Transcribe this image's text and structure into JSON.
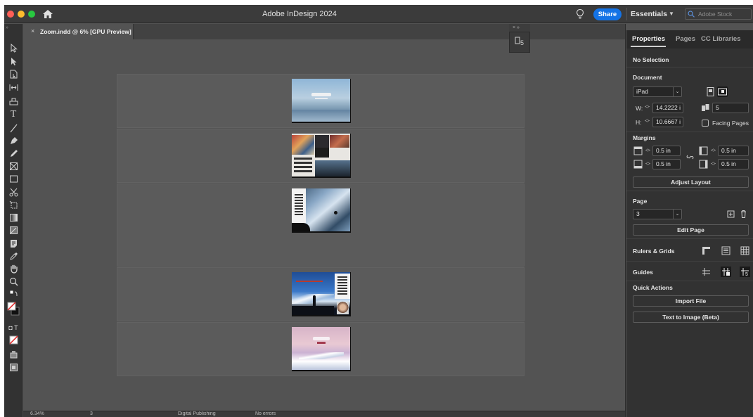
{
  "window": {
    "title": "Adobe InDesign 2024",
    "share_label": "Share",
    "workspace": "Essentials",
    "stock_search_placeholder": "Adobe Stock"
  },
  "document_tab": {
    "close_glyph": "×",
    "label": "Zoom.indd @ 6% [GPU Preview]"
  },
  "float_panel": {
    "header_glyphs": "× »"
  },
  "status_bar": {
    "zoom": "6.34%",
    "page": "3",
    "profile": "Digital Publishing",
    "errors": "No errors"
  },
  "panel": {
    "tabs": [
      {
        "label": "Properties",
        "active": true
      },
      {
        "label": "Pages",
        "active": false
      },
      {
        "label": "CC Libraries",
        "active": false
      }
    ],
    "selection_status": "No Selection",
    "document": {
      "title": "Document",
      "preset": "iPad",
      "width_label": "W:",
      "width": "14.2222 i",
      "height_label": "H:",
      "height": "10.6667 i",
      "pages_count": "5",
      "facing_pages_label": "Facing Pages",
      "facing_pages_checked": false
    },
    "margins": {
      "title": "Margins",
      "top": "0.5 in",
      "bottom": "0.5 in",
      "left": "0.5 in",
      "right": "0.5 in",
      "adjust_layout_label": "Adjust Layout"
    },
    "page": {
      "title": "Page",
      "current": "3",
      "edit_page_label": "Edit Page"
    },
    "rulers_grids": {
      "title": "Rulers & Grids"
    },
    "guides": {
      "title": "Guides"
    },
    "quick_actions": {
      "title": "Quick Actions",
      "import_file_label": "Import File",
      "text_to_image_label": "Text to Image (Beta)"
    }
  },
  "colors": {
    "app_bg": "#535353",
    "panel_bg": "#323232",
    "share_blue": "#1473e6"
  }
}
